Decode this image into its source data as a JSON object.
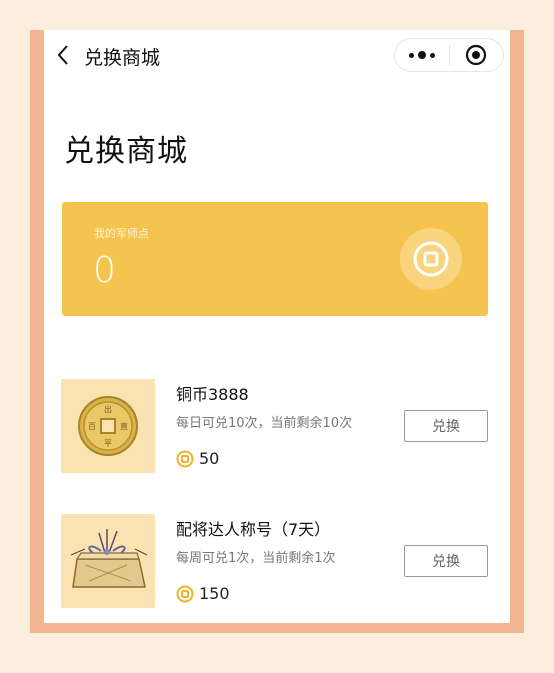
{
  "navbar": {
    "title": "兑换商城"
  },
  "page": {
    "title": "兑换商城"
  },
  "points": {
    "label": "我的军师点",
    "value": "0"
  },
  "items": [
    {
      "name": "铜币3888",
      "limit": "每日可兑10次，当前剩余10次",
      "price": "50",
      "button_label": "兑换",
      "icon": "copper-coin-image"
    },
    {
      "name": "配将达人称号（7天）",
      "limit": "每周可兑1次，当前剩余1次",
      "price": "150",
      "button_label": "兑换",
      "icon": "gift-box-image"
    }
  ],
  "colors": {
    "accent": "#f4c44f",
    "frame": "#f1b592",
    "background": "#fbeedd",
    "coin": "#f0b428"
  }
}
